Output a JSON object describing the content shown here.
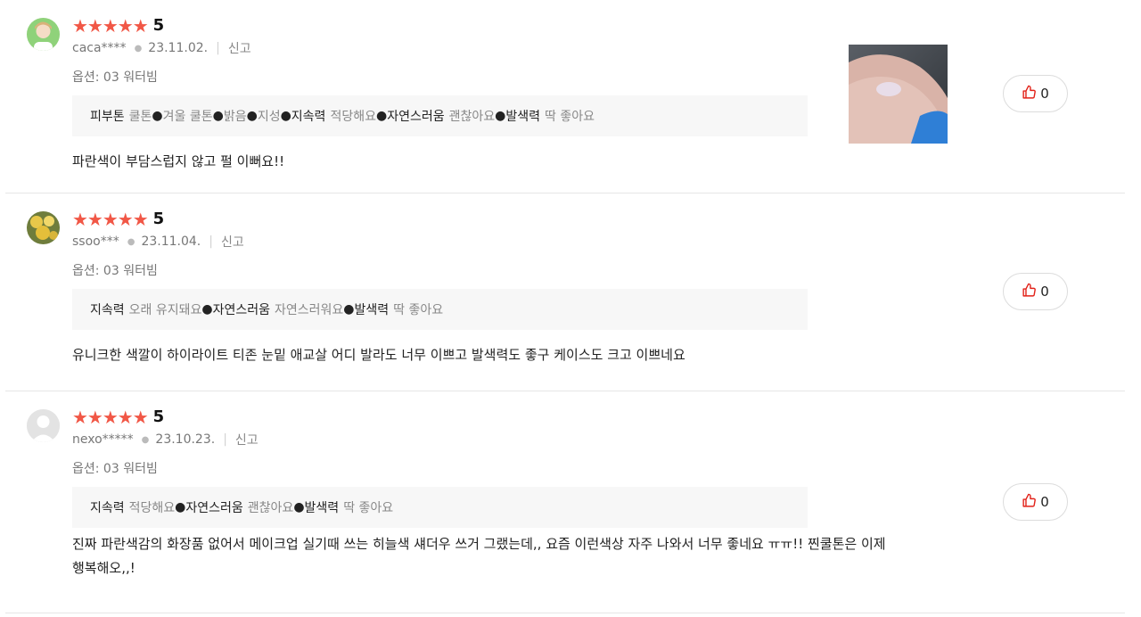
{
  "reviews": [
    {
      "stars": "★★★★★",
      "score": "5",
      "user": "caca****",
      "date": "23.11.02.",
      "report": "신고",
      "option": "옵션: 03 워터빔",
      "attrs": [
        {
          "key": "피부톤",
          "value": "쿨톤"
        },
        {
          "key": "",
          "value": "겨울 쿨톤"
        },
        {
          "key": "",
          "value": "밝음"
        },
        {
          "key": "",
          "value": "지성"
        },
        {
          "key": "지속력",
          "value": "적당해요"
        },
        {
          "key": "자연스러움",
          "value": "괜찮아요"
        },
        {
          "key": "발색력",
          "value": "딱 좋아요"
        }
      ],
      "text": "파란색이 부담스럽지 않고 펄 이뻐요!!",
      "likes": "0",
      "has_photo": true
    },
    {
      "stars": "★★★★★",
      "score": "5",
      "user": "ssoo***",
      "date": "23.11.04.",
      "report": "신고",
      "option": "옵션: 03 워터빔",
      "attrs": [
        {
          "key": "지속력",
          "value": "오래 유지돼요"
        },
        {
          "key": "자연스러움",
          "value": "자연스러워요"
        },
        {
          "key": "발색력",
          "value": "딱 좋아요"
        }
      ],
      "text": "유니크한 색깔이 하이라이트 티존 눈밑 애교살 어디 발라도 너무 이쁘고 발색력도 좋구 케이스도 크고 이쁘네요",
      "likes": "0",
      "has_photo": false
    },
    {
      "stars": "★★★★★",
      "score": "5",
      "user": "nexo*****",
      "date": "23.10.23.",
      "report": "신고",
      "option": "옵션: 03 워터빔",
      "attrs": [
        {
          "key": "지속력",
          "value": "적당해요"
        },
        {
          "key": "자연스러움",
          "value": "괜찮아요"
        },
        {
          "key": "발색력",
          "value": "딱 좋아요"
        }
      ],
      "text_line1": "진짜 파란색감의 화장품 없어서 메이크업 실기때 쓰는 히늘색 섀더우 쓰거 그랬는데,, 요즘 이런색상 자주 나와서 너무 좋네요 ㅠㅠ!! 찐쿨톤은 이제",
      "text_line2": "행복해오,,!",
      "likes": "0",
      "has_photo": false
    }
  ],
  "colors": {
    "star": "#f15746",
    "like_icon": "#e2231a"
  },
  "icons": {
    "like": "thumbs-up-icon"
  }
}
